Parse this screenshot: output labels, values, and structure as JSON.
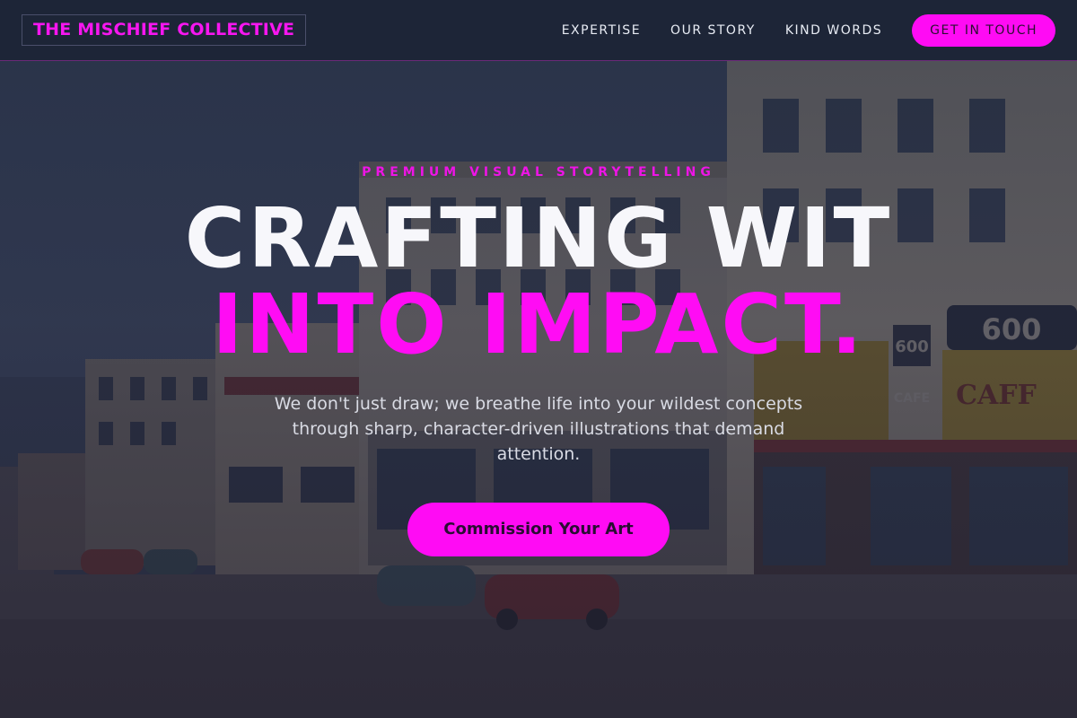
{
  "header": {
    "brand": "THE MISCHIEF COLLECTIVE",
    "nav": [
      {
        "label": "EXPERTISE"
      },
      {
        "label": "OUR STORY"
      },
      {
        "label": "KIND WORDS"
      }
    ],
    "cta": "GET IN TOUCH"
  },
  "hero": {
    "eyebrow": "PREMIUM VISUAL STORYTELLING",
    "headline_line1": "CRAFTING WIT",
    "headline_line2": "INTO IMPACT.",
    "subtext": "We don't just draw; we breathe life into your wildest concepts through sharp, character-driven illustrations that demand attention.",
    "cta": "Commission Your Art",
    "background_image": {
      "signs": [
        "600",
        "CAFE",
        "600",
        "CAFF"
      ]
    }
  },
  "colors": {
    "accent": "#ff0bf4",
    "header_bg": "#1d2537",
    "text_light": "#f7f7fb"
  }
}
